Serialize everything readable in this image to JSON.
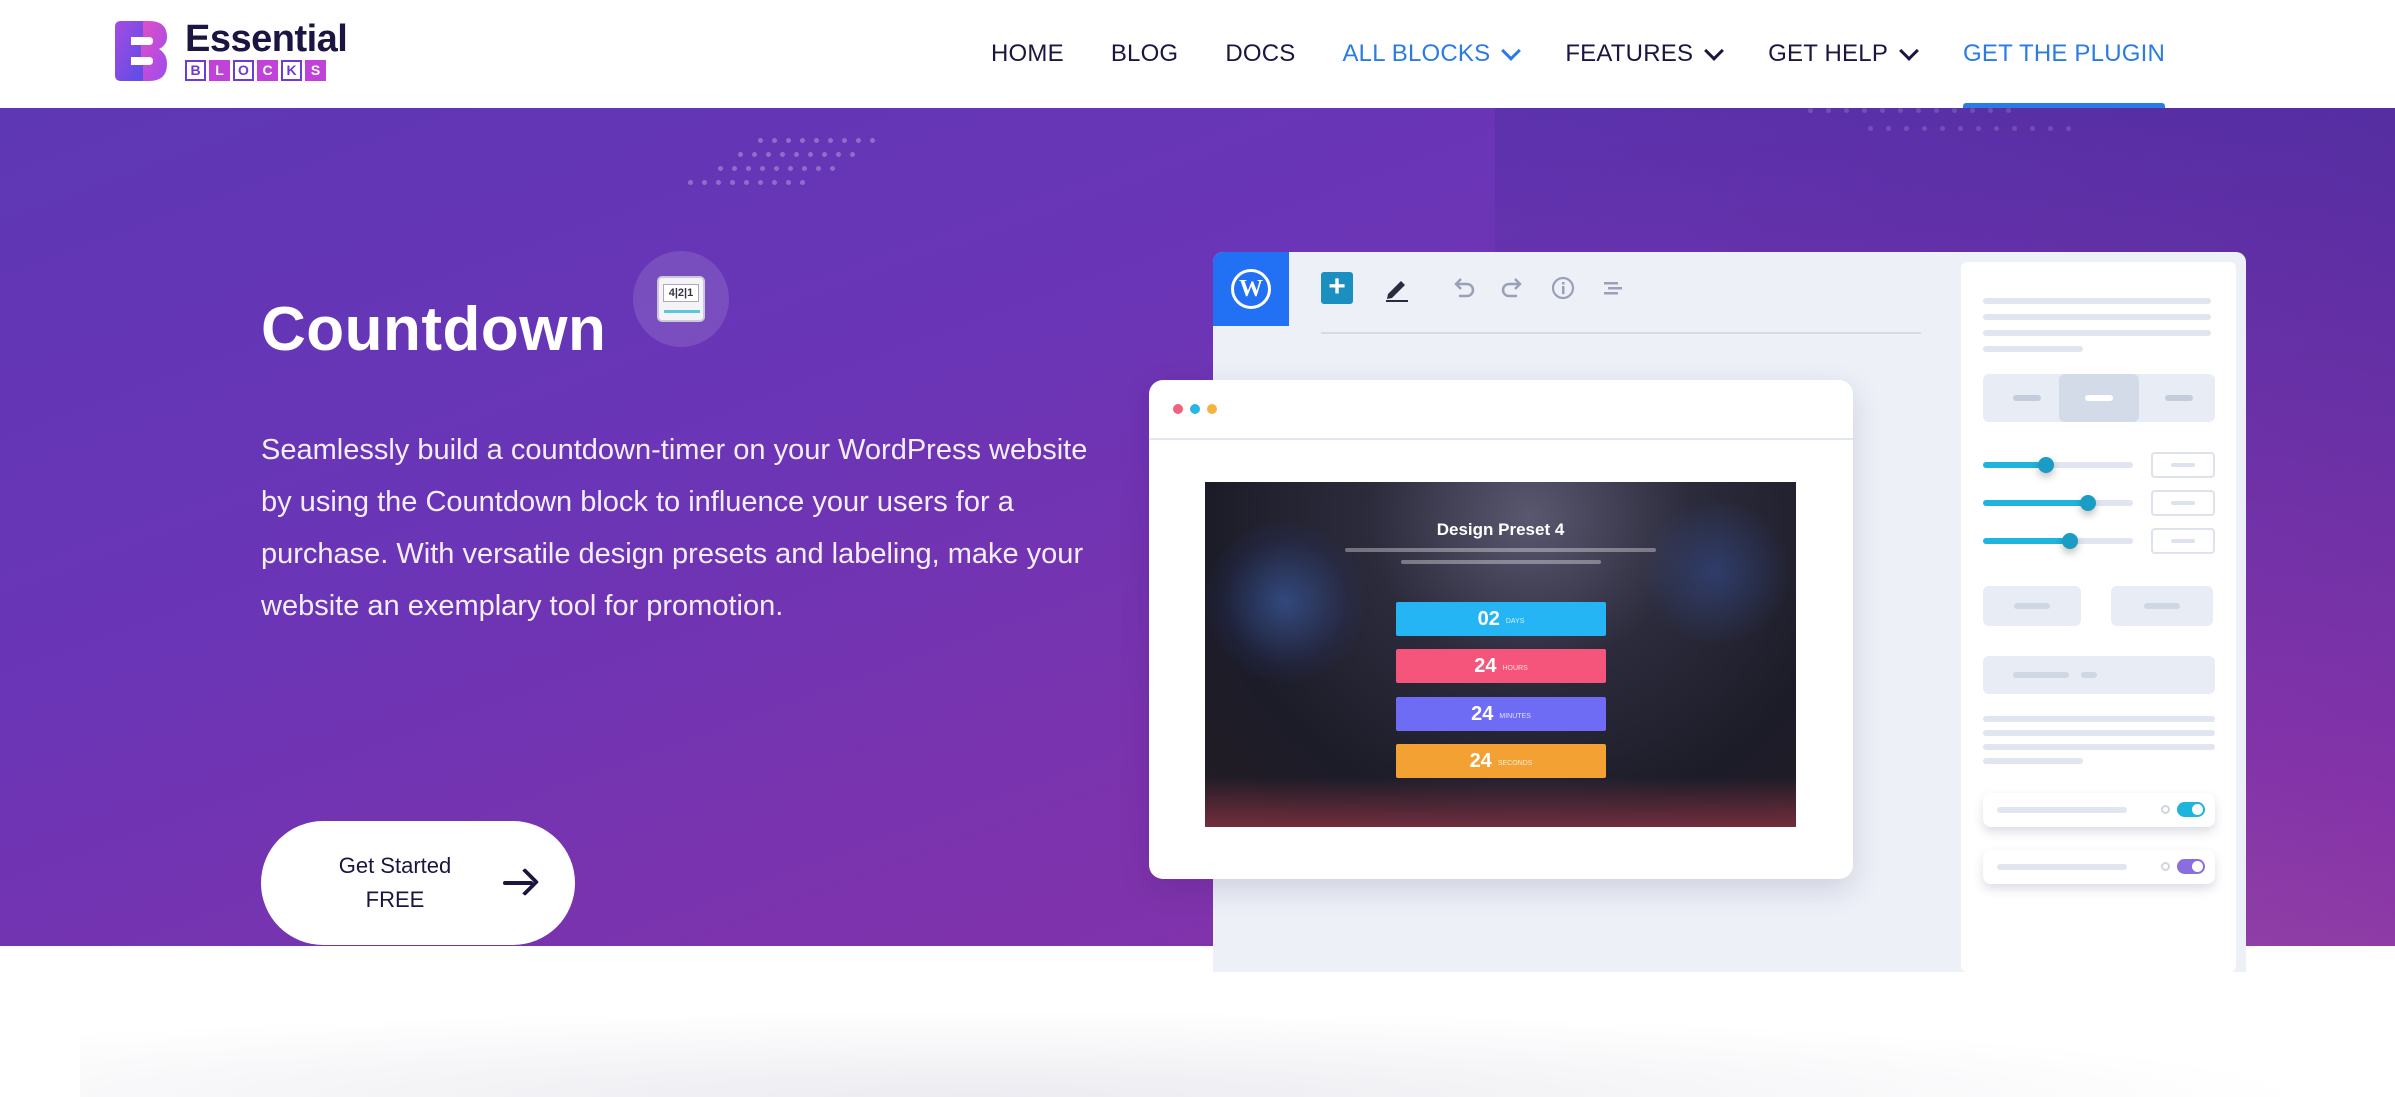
{
  "brand": {
    "word": "Essential",
    "letters": [
      "B",
      "L",
      "O",
      "C",
      "K",
      "S"
    ]
  },
  "nav": {
    "items": [
      {
        "label": "HOME"
      },
      {
        "label": "BLOG"
      },
      {
        "label": "DOCS"
      },
      {
        "label": "ALL BLOCKS",
        "dropdown": true
      },
      {
        "label": "FEATURES",
        "dropdown": true
      },
      {
        "label": "GET HELP",
        "dropdown": true
      },
      {
        "label": "GET THE PLUGIN"
      }
    ]
  },
  "hero": {
    "icon_digits": "4|2|1",
    "title": "Countdown",
    "description": "Seamlessly build a countdown-timer on your WordPress website by using the Countdown block to influence your users for a purchase. With versatile design presets and labeling, make your website an exemplary tool for promotion.",
    "cta_label": "Get Started FREE"
  },
  "editor": {
    "wp_glyph": "W",
    "sidebar": {
      "sliders": [
        0.42,
        0.7,
        0.58
      ],
      "toggles": [
        {
          "color": "#1fb4dc",
          "on": true
        },
        {
          "color": "#8a6ee0",
          "on": true
        }
      ]
    }
  },
  "preview": {
    "title": "Design Preset 4",
    "rows": [
      {
        "value": "02",
        "unit": "DAYS",
        "color": "#25b5f4"
      },
      {
        "value": "24",
        "unit": "HOURS",
        "color": "#f5557a"
      },
      {
        "value": "24",
        "unit": "MINUTES",
        "color": "#6e6cf5"
      },
      {
        "value": "24",
        "unit": "SECONDS",
        "color": "#f4a133"
      }
    ]
  },
  "colors": {
    "accent_blue": "#2a7be4",
    "brand_dark": "#1c1541",
    "hero_purple": "#6a35b6"
  }
}
